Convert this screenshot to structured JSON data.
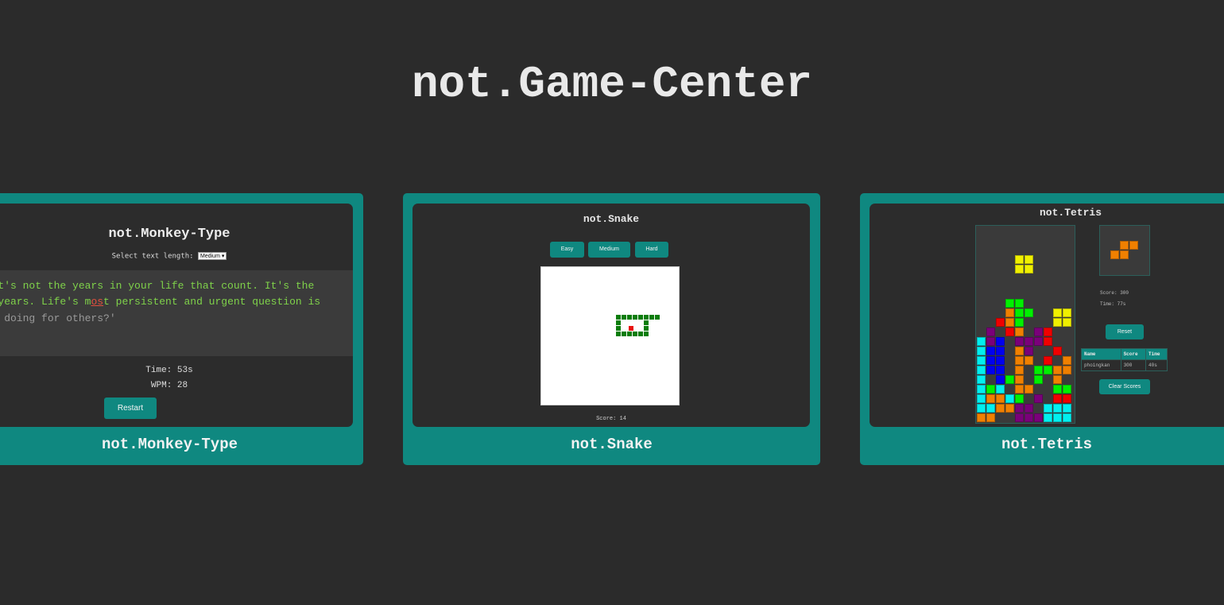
{
  "site": {
    "title": "not.Game-Center"
  },
  "colors": {
    "background": "#2b2b2b",
    "accent": "#0f8880",
    "typed": "#7fd24a",
    "error": "#e2503e",
    "snake": "#0a7d0a",
    "food": "#e8120c"
  },
  "cards": {
    "monkey": {
      "label": "not.Monkey-Type",
      "title": "not.Monkey-Type",
      "length_label": "Select text length:",
      "length_value": "Medium",
      "line1": ". it's not the years in your life that count. It's the",
      "line2_typed_a": "ur years. Life's m",
      "line2_wrong": "os",
      "line2_typed_b": "t persistent and urgent question is",
      "line3": "you doing for others?'",
      "time": "Time: 53s",
      "wpm": "WPM: 28",
      "restart": "Restart"
    },
    "snake": {
      "label": "not.Snake",
      "title": "not.Snake",
      "buttons": [
        "Easy",
        "Medium",
        "Hard"
      ],
      "score": "Score: 14"
    },
    "tetris": {
      "label": "not.Tetris",
      "title": "not.Tetris",
      "score": "Score: 300",
      "time": "Time: 77s",
      "reset": "Reset",
      "table_headers": [
        "Name",
        "Score",
        "Time"
      ],
      "table_rows": [
        [
          "phoingkan",
          "300",
          "40s"
        ]
      ],
      "clear_scores": "Clear Scores"
    }
  }
}
